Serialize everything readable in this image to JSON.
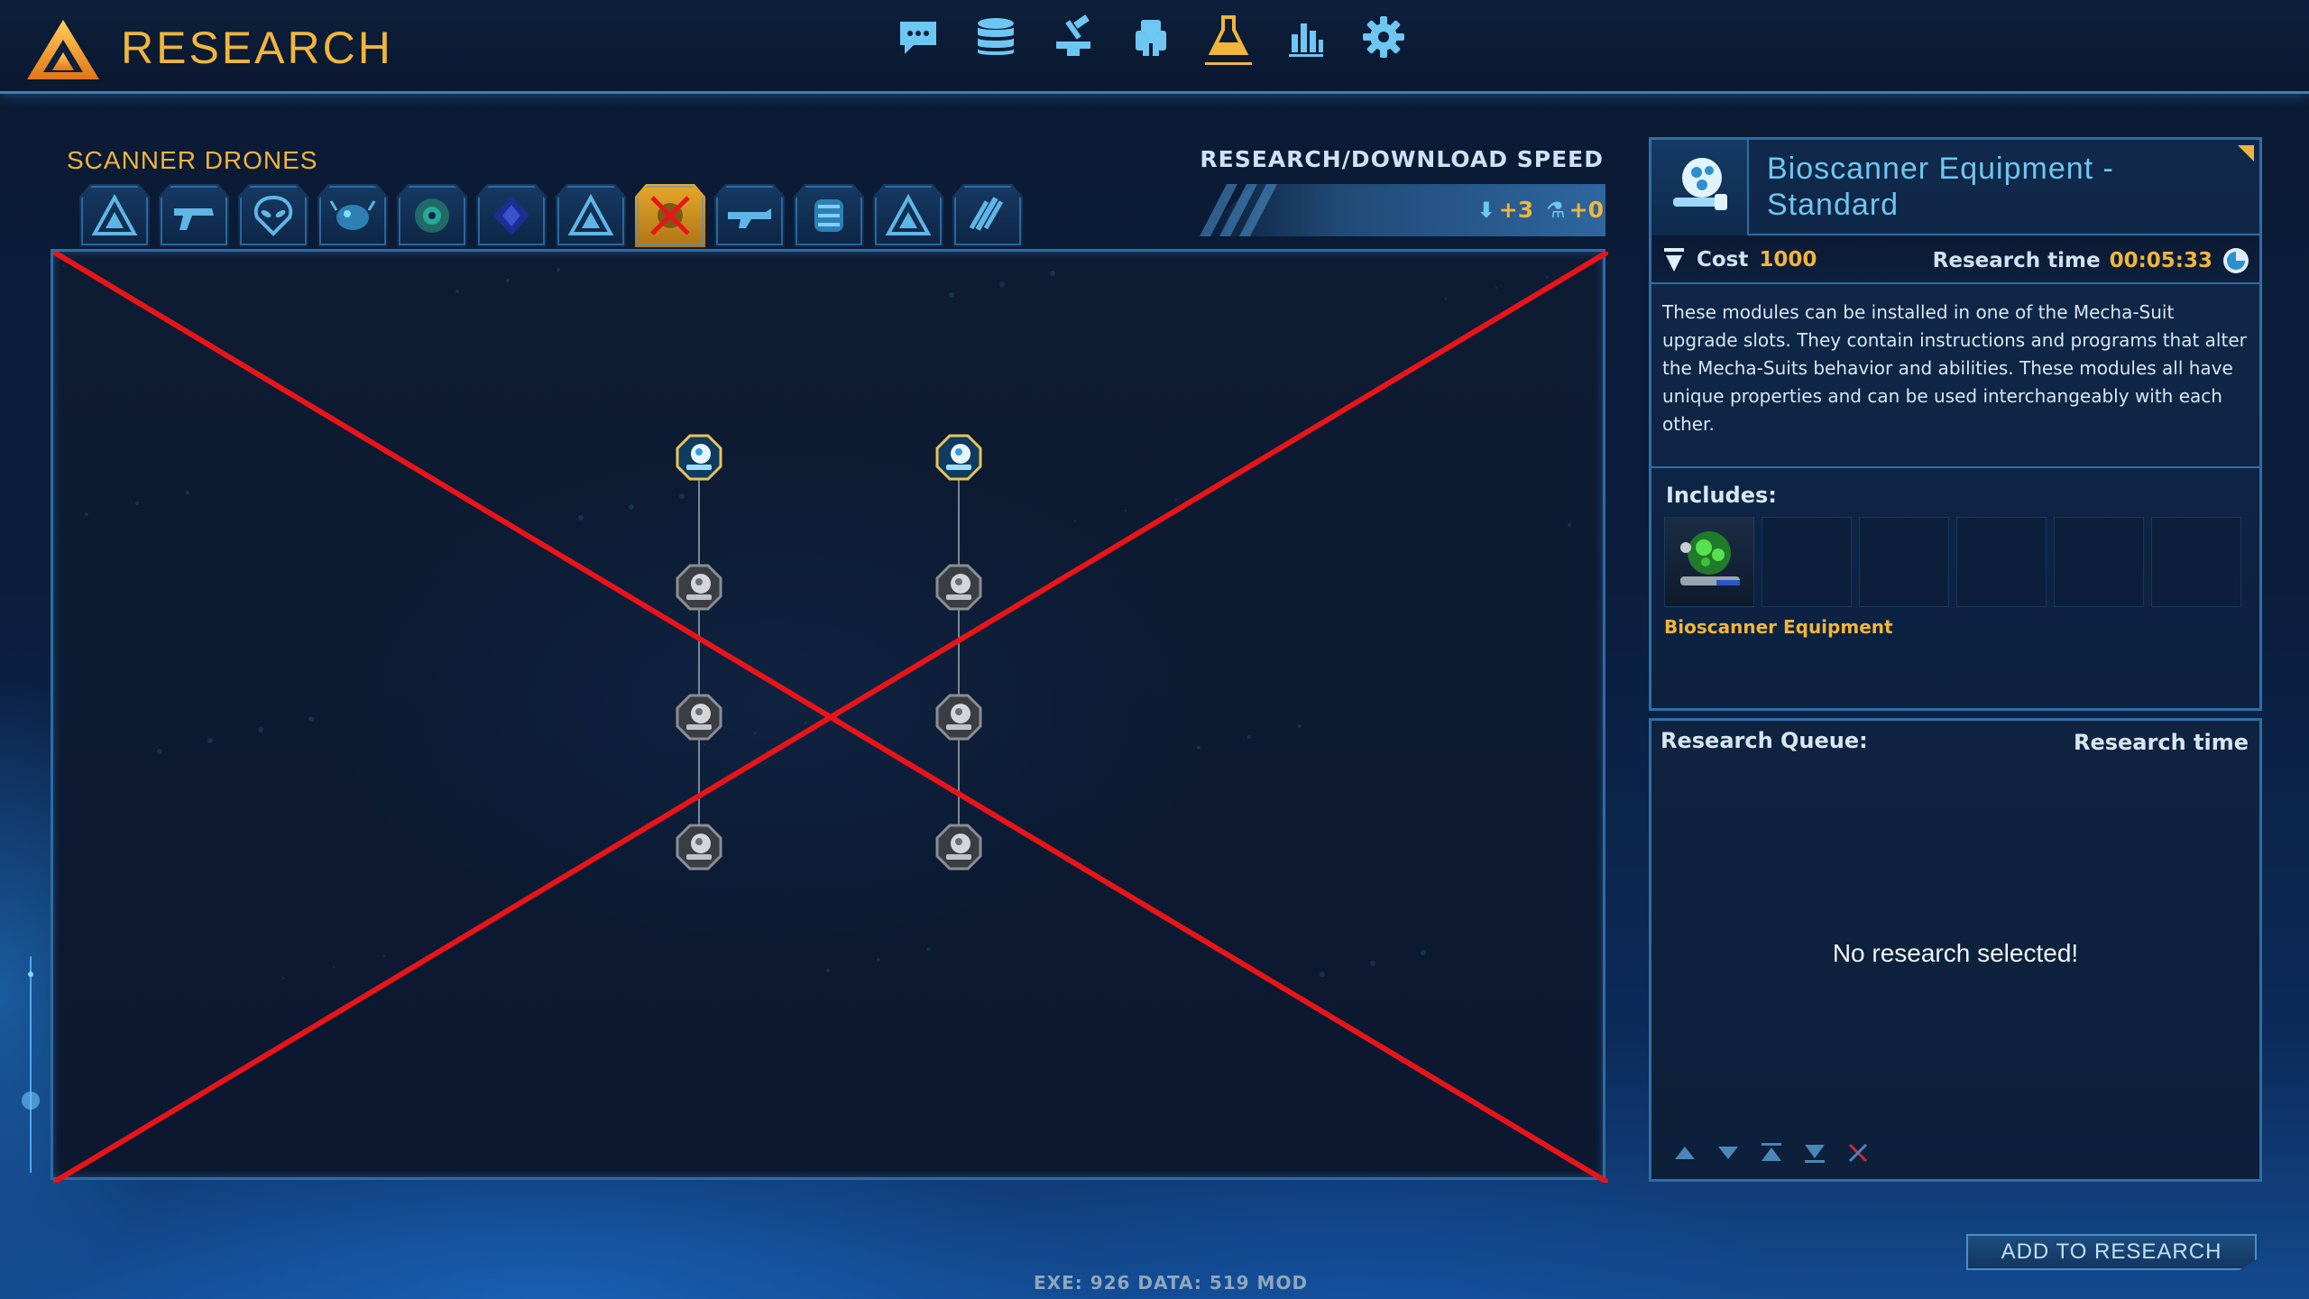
{
  "header": {
    "title": "RESEARCH",
    "nav": [
      {
        "name": "chat-icon"
      },
      {
        "name": "database-icon"
      },
      {
        "name": "manufacture-icon"
      },
      {
        "name": "mech-icon"
      },
      {
        "name": "research-flask-icon",
        "active": true
      },
      {
        "name": "statistics-icon"
      },
      {
        "name": "settings-gear-icon"
      }
    ]
  },
  "left": {
    "category_title": "SCANNER DRONES",
    "speed_label": "RESEARCH/DOWNLOAD SPEED",
    "speed_download": "+3",
    "speed_research": "+0",
    "categories": [
      "a-logo",
      "gun",
      "alien",
      "creature",
      "alien-head",
      "crystal",
      "a-logo-2",
      "scanner-drones",
      "rifle",
      "armor",
      "a-logo-3",
      "missiles"
    ],
    "active_category": 7,
    "tree_nodes": [
      {
        "col": 0,
        "row": 0,
        "state": "available"
      },
      {
        "col": 0,
        "row": 1,
        "state": "locked"
      },
      {
        "col": 0,
        "row": 2,
        "state": "locked"
      },
      {
        "col": 0,
        "row": 3,
        "state": "locked"
      },
      {
        "col": 1,
        "row": 0,
        "state": "available"
      },
      {
        "col": 1,
        "row": 1,
        "state": "locked"
      },
      {
        "col": 1,
        "row": 2,
        "state": "locked"
      },
      {
        "col": 1,
        "row": 3,
        "state": "locked"
      }
    ]
  },
  "detail": {
    "title": "Bioscanner Equipment - Standard",
    "cost_label": "Cost",
    "cost_value": "1000",
    "time_label": "Research time",
    "time_value": "00:05:33",
    "description": "These modules can be installed in one of the Mecha-Suit upgrade slots. They contain instructions and programs that alter the Mecha-Suits behavior and abilities. These modules all have unique properties and can be used interchangeably with each other.",
    "includes_label": "Includes:",
    "includes_item": "Bioscanner Equipment"
  },
  "queue": {
    "title": "Research Queue:",
    "time_label": "Research time",
    "empty_text": "No research selected!"
  },
  "add_button": "ADD TO RESEARCH",
  "footer": "EXE: 926  DATA: 519  MOD",
  "colors": {
    "accent_gold": "#f0b53c",
    "accent_blue": "#6fc6ef",
    "frame_blue": "#2f6ea4",
    "red_cross": "#e8141a"
  }
}
